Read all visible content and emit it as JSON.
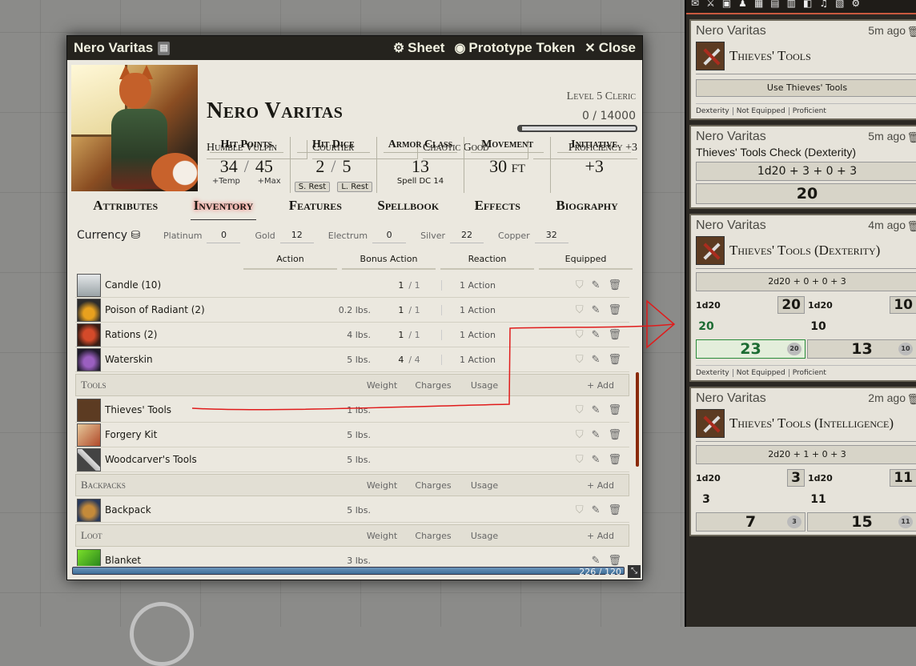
{
  "sheet": {
    "title": "Nero Varitas",
    "buttons": {
      "sheet": "Sheet",
      "prototype_token": "Prototype Token",
      "close": "Close"
    },
    "name": "Nero Varitas",
    "level": "Level 5 Cleric",
    "xp": "0 / 14000",
    "xp_progress": 0.03,
    "details": {
      "race": "Humble Vulpin",
      "background": "Courtier",
      "alignment": "Chaotic Good",
      "proficiency": "Proficiency +3"
    },
    "attributes": {
      "hp": {
        "label": "Hit Points",
        "value": "34",
        "max": "45",
        "temp_label": "+Temp",
        "max_label": "+Max"
      },
      "hit_dice": {
        "label": "Hit Dice",
        "value": "2",
        "max": "5",
        "short_rest": "S. Rest",
        "long_rest": "L. Rest"
      },
      "ac": {
        "label": "Armor Class",
        "value": "13",
        "sub": "Spell DC 14"
      },
      "movement": {
        "label": "Movement",
        "value": "30 ft"
      },
      "initiative": {
        "label": "Initiative",
        "value": "+3"
      }
    },
    "tabs": [
      "Attributes",
      "Inventory",
      "Features",
      "Spellbook",
      "Effects",
      "Biography"
    ],
    "currency": {
      "label": "Currency",
      "items": [
        {
          "name": "Platinum",
          "value": "0"
        },
        {
          "name": "Gold",
          "value": "12"
        },
        {
          "name": "Electrum",
          "value": "0"
        },
        {
          "name": "Silver",
          "value": "22"
        },
        {
          "name": "Copper",
          "value": "32"
        }
      ]
    },
    "action_filters": [
      "Action",
      "Bonus Action",
      "Reaction",
      "Equipped"
    ],
    "consumables": [
      {
        "name": "Candle (10)",
        "weight": "",
        "uses": "1",
        "max": "/ 1",
        "action": "1 Action"
      },
      {
        "name": "Poison of Radiant (2)",
        "weight": "0.2 lbs.",
        "uses": "1",
        "max": "/ 1",
        "action": "1 Action"
      },
      {
        "name": "Rations (2)",
        "weight": "4 lbs.",
        "uses": "1",
        "max": "/ 1",
        "action": "1 Action"
      },
      {
        "name": "Waterskin",
        "weight": "5 lbs.",
        "uses": "4",
        "max": "/ 4",
        "action": "1 Action"
      }
    ],
    "sections": {
      "tools": {
        "title": "Tools",
        "weight": "Weight",
        "charges": "Charges",
        "usage": "Usage",
        "add": "+ Add"
      },
      "backpacks": {
        "title": "Backpacks",
        "weight": "Weight",
        "charges": "Charges",
        "usage": "Usage",
        "add": "+ Add"
      },
      "loot": {
        "title": "Loot",
        "weight": "Weight",
        "charges": "Charges",
        "usage": "Usage",
        "add": "+ Add"
      }
    },
    "tools": [
      {
        "name": "Thieves' Tools",
        "weight": "1 lbs."
      },
      {
        "name": "Forgery Kit",
        "weight": "5 lbs."
      },
      {
        "name": "Woodcarver's Tools",
        "weight": "5 lbs."
      }
    ],
    "backpacks": [
      {
        "name": "Backpack",
        "weight": "5 lbs."
      }
    ],
    "loot": [
      {
        "name": "Blanket",
        "weight": "3 lbs."
      }
    ],
    "encumbrance": "226 / 120"
  },
  "chat": {
    "messages": [
      {
        "author": "Nero Varitas",
        "time": "5m ago",
        "item": "Thieves' Tools",
        "button": "Use Thieves' Tools",
        "props": [
          "Dexterity",
          "Not Equipped",
          "Proficient"
        ]
      },
      {
        "author": "Nero Varitas",
        "time": "5m ago",
        "flavor": "Thieves' Tools Check (Dexterity)",
        "formula": "1d20 + 3 + 0 + 3",
        "total": "20"
      },
      {
        "author": "Nero Varitas",
        "time": "4m ago",
        "item": "Thieves' Tools (Dexterity)",
        "formula": "2d20 + 0 + 0 + 3",
        "rolls": [
          {
            "die": "1d20",
            "result": "20",
            "face": "20",
            "total": "23",
            "mini": "20"
          },
          {
            "die": "1d20",
            "result": "10",
            "face": "10",
            "total": "13",
            "mini": "10"
          }
        ],
        "props": [
          "Dexterity",
          "Not Equipped",
          "Proficient"
        ]
      },
      {
        "author": "Nero Varitas",
        "time": "2m ago",
        "item": "Thieves' Tools (Intelligence)",
        "formula": "2d20 + 1 + 0 + 3",
        "rolls": [
          {
            "die": "1d20",
            "result": "3",
            "face": "3",
            "total": "7",
            "mini": "3"
          },
          {
            "die": "1d20",
            "result": "11",
            "face": "11",
            "total": "15",
            "mini": "11"
          }
        ]
      }
    ]
  },
  "colors": {
    "accent": "#c9593f",
    "parchment": "#ebe8df",
    "header": "#25231e",
    "annotation": "#e01b1b"
  }
}
